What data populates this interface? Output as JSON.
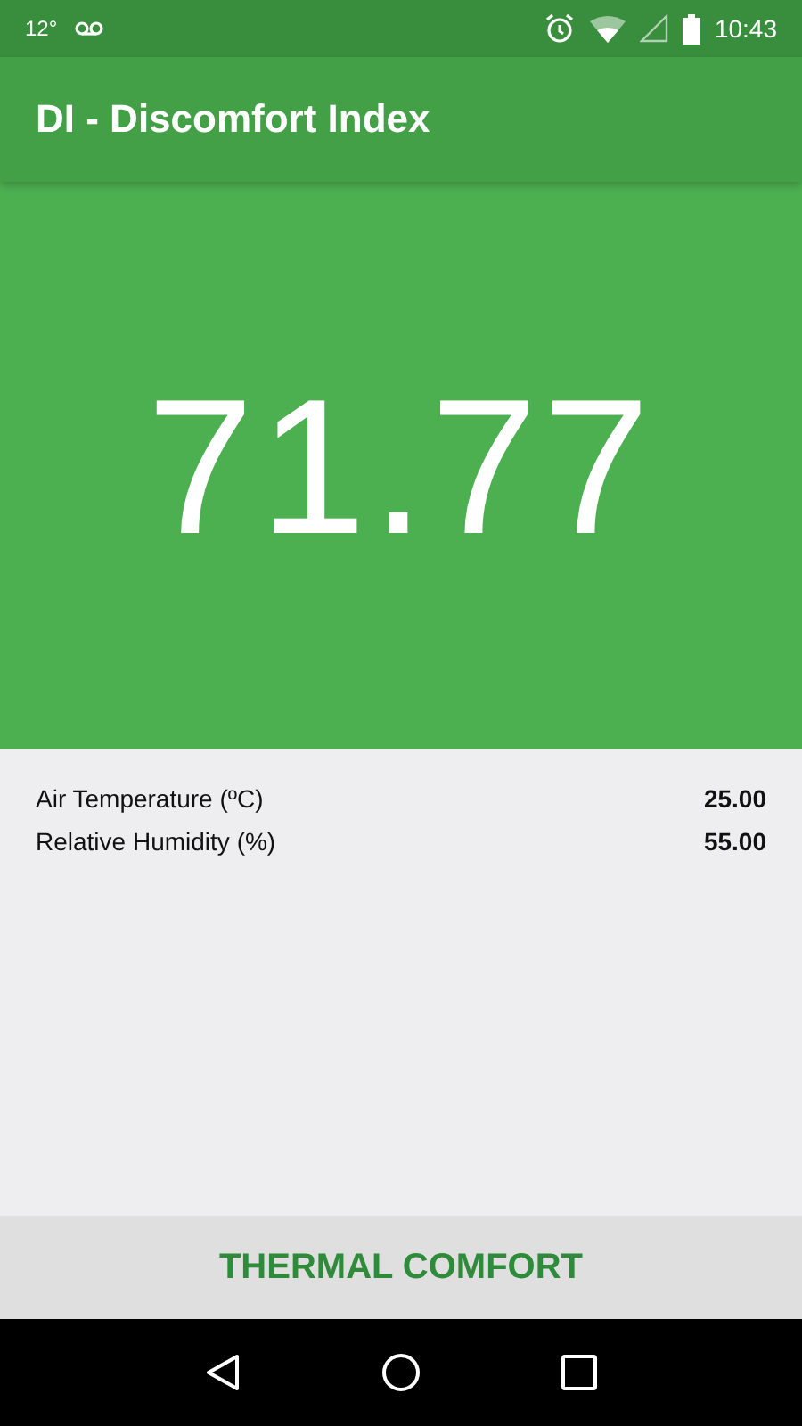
{
  "status_bar": {
    "temperature": "12°",
    "time": "10:43"
  },
  "app_bar": {
    "title": "DI - Discomfort Index"
  },
  "result": {
    "value": "71.77"
  },
  "readings": [
    {
      "label": "Air Temperature (ºC)",
      "value": "25.00"
    },
    {
      "label": "Relative Humidity (%)",
      "value": "55.00"
    }
  ],
  "comfort_label": "THERMAL COMFORT"
}
